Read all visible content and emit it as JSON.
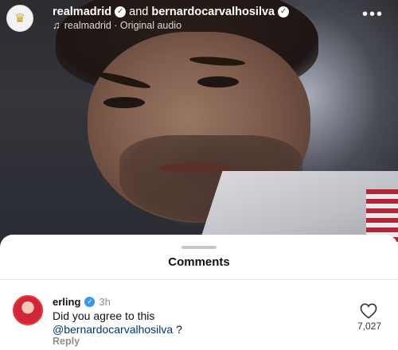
{
  "header": {
    "account_primary": "realmadrid",
    "conjunction": "and",
    "account_secondary": "bernardocarvalhosilva",
    "audio_label": "realmadrid · Original audio",
    "more_icon": "more-dots-icon"
  },
  "comments_sheet": {
    "title": "Comments",
    "comment": {
      "username": "erling",
      "time": "3h",
      "text_line1": "Did you agree to this",
      "mention": "@bernardocarvalhosilva",
      "text_suffix": " ?",
      "reply_label": "Reply",
      "like_count": "7,027"
    }
  },
  "colors": {
    "sheet_bg": "#ffffff",
    "verified_blue": "#3897f0",
    "mention": "#00376b",
    "muted_text": "#8e8e8e"
  }
}
